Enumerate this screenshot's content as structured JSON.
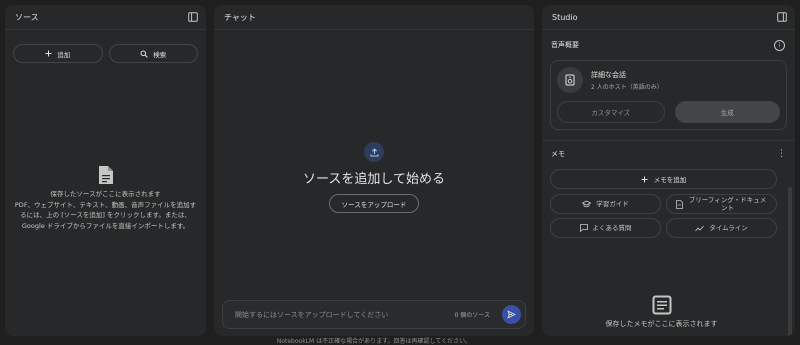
{
  "sources": {
    "title": "ソース",
    "add_label": "追加",
    "search_label": "検索",
    "empty_title": "保存したソースがここに表示されます",
    "empty_desc": "PDF、ウェブサイト、テキスト、動画、音声ファイルを追加するには、上の [ソースを追加] をクリックします。または、Google ドライブからファイルを直接インポートします。"
  },
  "chat": {
    "title": "チャット",
    "heading": "ソースを追加して始める",
    "upload_label": "ソースをアップロード",
    "input_placeholder": "開始するにはソースをアップロードしてください",
    "source_count": "0 個のソース",
    "footer_note": "NotebookLM は不正確な場合があります。回答は再確認してください。"
  },
  "studio": {
    "title": "Studio",
    "audio_overview_label": "音声概要",
    "audio_card": {
      "title": "詳細な会話",
      "subtitle": "2 人のホスト（英語のみ）",
      "customize_label": "カスタマイズ",
      "generate_label": "生成"
    },
    "memo_label": "メモ",
    "add_memo_label": "メモを追加",
    "memo_buttons": [
      {
        "label": "学習ガイド",
        "icon": "graduation-cap-icon"
      },
      {
        "label": "ブリーフィング・ドキュメント",
        "icon": "document-icon"
      },
      {
        "label": "よくある質問",
        "icon": "chat-question-icon"
      },
      {
        "label": "タイムライン",
        "icon": "timeline-icon"
      }
    ],
    "memo_empty": "保存したメモがここに表示されます"
  },
  "colors": {
    "background": "#1f1f1f",
    "panel": "#272829",
    "accent": "#3a4fa8"
  }
}
